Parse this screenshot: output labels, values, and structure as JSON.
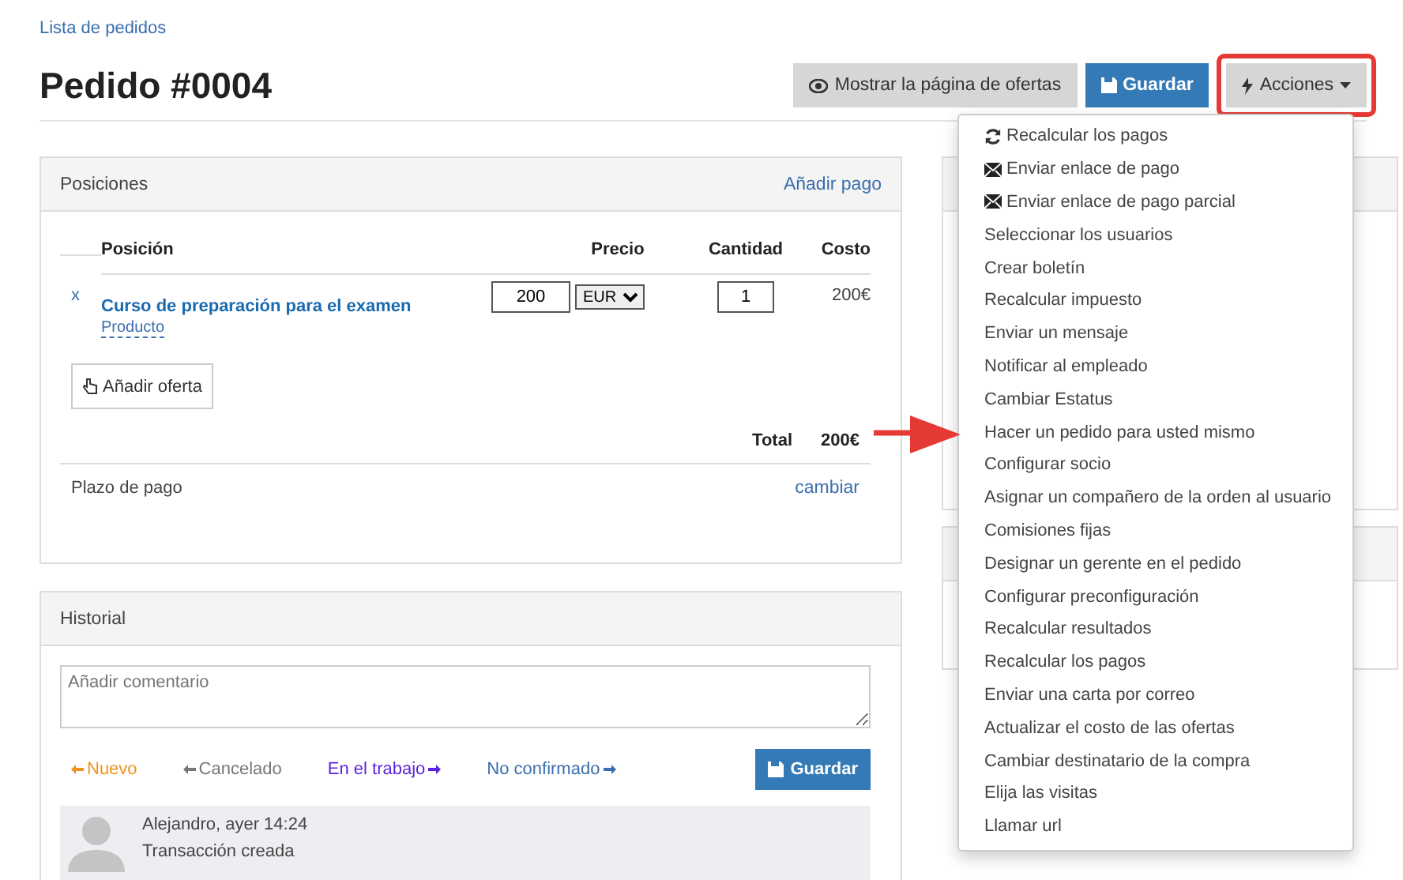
{
  "breadcrumb": "Lista de pedidos",
  "title": "Pedido #0004",
  "toolbar": [
    {
      "label": "Mostrar la página de ofertas",
      "kind": "eye"
    },
    {
      "label": "Guardar",
      "kind": "save"
    },
    {
      "label": "Acciones",
      "kind": "menu",
      "highlighted": true,
      "expanded": true
    }
  ],
  "actions_menu": [
    {
      "label": "Recalcular los pagos",
      "kind": "refresh"
    },
    {
      "label": "Enviar enlace de pago",
      "kind": "mail"
    },
    {
      "label": "Enviar enlace de pago parcial",
      "kind": "mail"
    },
    {
      "label": "Seleccionar los usuarios",
      "kind": "plain"
    },
    {
      "label": "Crear boletín",
      "kind": "plain"
    },
    {
      "label": "Recalcular impuesto",
      "kind": "plain"
    },
    {
      "label": "Enviar un mensaje",
      "kind": "plain"
    },
    {
      "label": "Notificar al empleado",
      "kind": "plain"
    },
    {
      "label": "Cambiar Estatus",
      "kind": "plain"
    },
    {
      "label": "Hacer un pedido para usted mismo",
      "kind": "plain",
      "pointed": true
    },
    {
      "label": "Configurar socio",
      "kind": "plain"
    },
    {
      "label": "Asignar un compañero de la orden al usuario",
      "kind": "plain"
    },
    {
      "label": "Comisiones fijas",
      "kind": "plain"
    },
    {
      "label": "Designar un gerente en el pedido",
      "kind": "plain"
    },
    {
      "label": "Configurar preconfiguración",
      "kind": "plain"
    },
    {
      "label": "Recalcular resultados",
      "kind": "plain"
    },
    {
      "label": "Recalcular los pagos",
      "kind": "plain"
    },
    {
      "label": "Enviar una carta por correo",
      "kind": "plain"
    },
    {
      "label": "Actualizar el costo de las ofertas",
      "kind": "plain"
    },
    {
      "label": "Cambiar destinatario de la compra",
      "kind": "plain"
    },
    {
      "label": "Elija las visitas",
      "kind": "plain"
    },
    {
      "label": "Llamar url",
      "kind": "plain"
    }
  ],
  "positions": {
    "title": "Posiciones",
    "action": "Añadir pago",
    "columns": [
      "Posición",
      "Precio",
      "Cantidad",
      "Costo"
    ],
    "rows": [
      {
        "remove": "x",
        "name": "Curso de preparación para el examen",
        "type": "Producto",
        "price": "200",
        "currency": "EUR",
        "quantity": "1",
        "cost": "200€"
      }
    ],
    "add_offer": "Añadir oferta",
    "total_label": "Total",
    "total": "200€",
    "payment_term": "Plazo de pago",
    "change": "cambiar"
  },
  "history": {
    "title": "Historial",
    "comment_placeholder": "Añadir comentario",
    "statuses": [
      {
        "label": "Nuevo",
        "kind": "back",
        "color": "#f0931e"
      },
      {
        "label": "Cancelado",
        "kind": "back",
        "color": "#777777"
      },
      {
        "label": "En el trabajo",
        "kind": "forward",
        "color": "#5a22e0"
      },
      {
        "label": "No confirmado",
        "kind": "forward",
        "color": "#3a6eae"
      }
    ],
    "save": "Guardar",
    "entries": [
      {
        "author": "Alejandro, ayer 14:24",
        "text": "Transacción creada"
      }
    ]
  }
}
